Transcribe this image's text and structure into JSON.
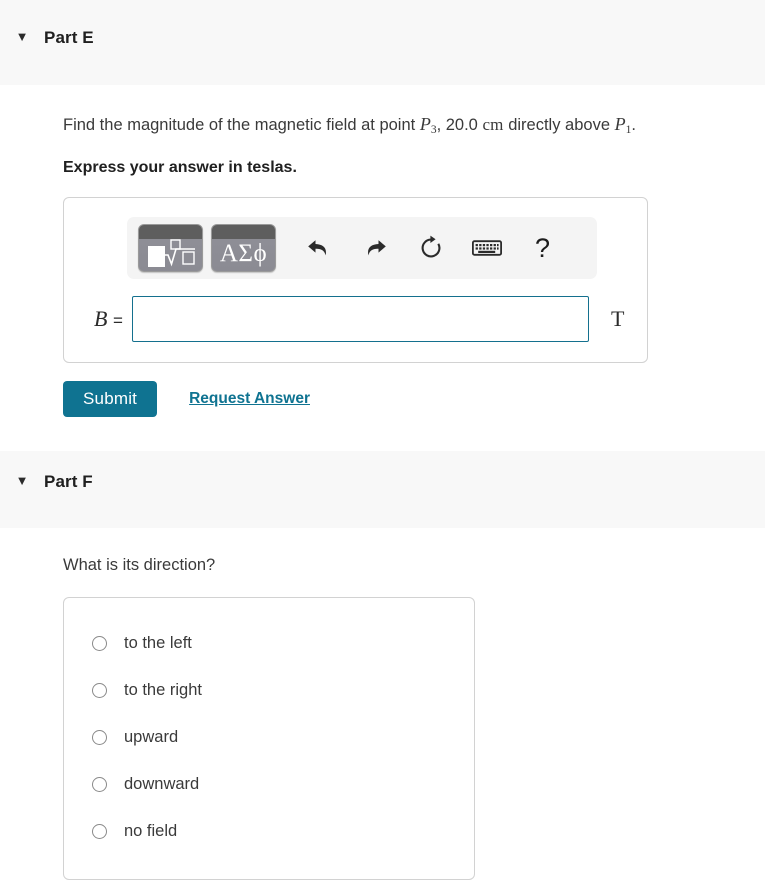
{
  "parts": {
    "e": {
      "caret": "▼",
      "title": "Part E",
      "question": {
        "lead": "Find the magnitude of the magnetic field at point ",
        "var1": "P",
        "var1_sub": "3",
        "middle": ", 20.0 ",
        "unit_cm": "cm",
        "middle2": " directly above ",
        "var2": "P",
        "var2_sub": "1",
        "tail": "."
      },
      "instruction": "Express your answer in teslas.",
      "toolbar": {
        "template_button": "math-template",
        "greek_button": "ΑΣϕ",
        "undo": "undo-icon",
        "redo": "redo-icon",
        "reset": "reset-icon",
        "keyboard": "keyboard-icon",
        "help": "?"
      },
      "input": {
        "label_var": "B",
        "label_eq": "=",
        "value": "",
        "placeholder": "",
        "unit": "T"
      },
      "submit_label": "Submit",
      "request_answer_label": "Request Answer"
    },
    "f": {
      "caret": "▼",
      "title": "Part F",
      "question": "What is its direction?",
      "choices": [
        {
          "label": "to the left",
          "selected": false
        },
        {
          "label": "to the right",
          "selected": false
        },
        {
          "label": "upward",
          "selected": false
        },
        {
          "label": "downward",
          "selected": false
        },
        {
          "label": "no field",
          "selected": false
        }
      ]
    }
  },
  "colors": {
    "accent": "#0f7391",
    "band": "#f8f8f8",
    "input_border": "#14708e",
    "box_border": "#d2d2d2",
    "text": "#3a3a3a"
  }
}
